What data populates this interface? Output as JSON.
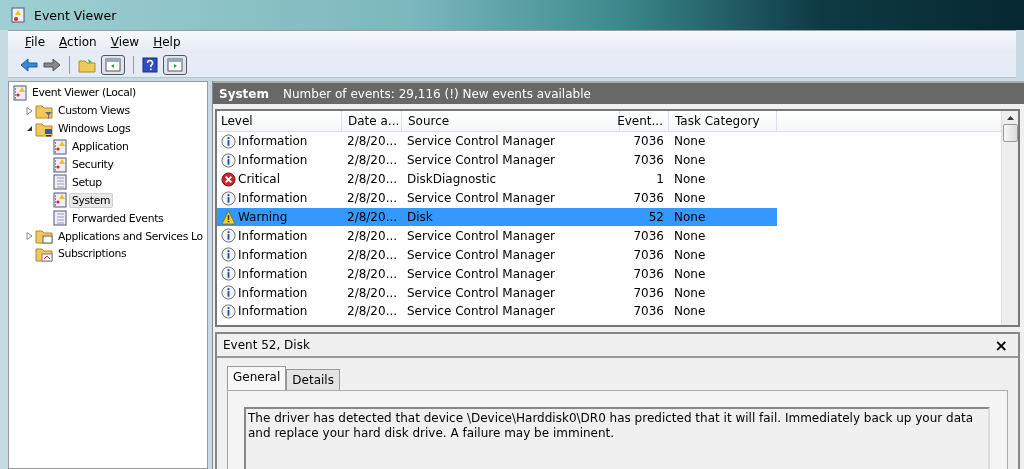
{
  "window": {
    "title": "Event Viewer"
  },
  "menu": [
    "File",
    "Action",
    "View",
    "Help"
  ],
  "tree": [
    {
      "label": "Event Viewer (Local)",
      "kind": "viewer",
      "selected": false,
      "children": [
        {
          "label": "Custom Views",
          "kind": "folder-filter",
          "expanded": false,
          "selected": false
        },
        {
          "label": "Windows Logs",
          "kind": "folder-computer",
          "expanded": true,
          "selected": false,
          "children": [
            {
              "label": "Application",
              "kind": "log-alert",
              "selected": false
            },
            {
              "label": "Security",
              "kind": "log-alert",
              "selected": false
            },
            {
              "label": "Setup",
              "kind": "log",
              "selected": false
            },
            {
              "label": "System",
              "kind": "log-alert",
              "selected": true
            },
            {
              "label": "Forwarded Events",
              "kind": "log",
              "selected": false
            }
          ]
        },
        {
          "label": "Applications and Services Lo",
          "kind": "folder-window",
          "expanded": false,
          "selected": false
        },
        {
          "label": "Subscriptions",
          "kind": "subscriptions",
          "selected": false
        }
      ]
    }
  ],
  "header": {
    "title": "System",
    "info": "Number of events: 29,116 (!) New events available"
  },
  "table": {
    "columns": [
      "Level",
      "Date a...",
      "Source",
      "Event...",
      "Task Category"
    ],
    "rows": [
      {
        "kind": "info",
        "level": "Information",
        "date": "2/8/20...",
        "source": "Service Control Manager",
        "event": "7036",
        "category": "None",
        "selected": false
      },
      {
        "kind": "info",
        "level": "Information",
        "date": "2/8/20...",
        "source": "Service Control Manager",
        "event": "7036",
        "category": "None",
        "selected": false
      },
      {
        "kind": "critical",
        "level": "Critical",
        "date": "2/8/20...",
        "source": "DiskDiagnostic",
        "event": "1",
        "category": "None",
        "selected": false
      },
      {
        "kind": "info",
        "level": "Information",
        "date": "2/8/20...",
        "source": "Service Control Manager",
        "event": "7036",
        "category": "None",
        "selected": false
      },
      {
        "kind": "warning",
        "level": "Warning",
        "date": "2/8/20...",
        "source": "Disk",
        "event": "52",
        "category": "None",
        "selected": true
      },
      {
        "kind": "info",
        "level": "Information",
        "date": "2/8/20...",
        "source": "Service Control Manager",
        "event": "7036",
        "category": "None",
        "selected": false
      },
      {
        "kind": "info",
        "level": "Information",
        "date": "2/8/20...",
        "source": "Service Control Manager",
        "event": "7036",
        "category": "None",
        "selected": false
      },
      {
        "kind": "info",
        "level": "Information",
        "date": "2/8/20...",
        "source": "Service Control Manager",
        "event": "7036",
        "category": "None",
        "selected": false
      },
      {
        "kind": "info",
        "level": "Information",
        "date": "2/8/20...",
        "source": "Service Control Manager",
        "event": "7036",
        "category": "None",
        "selected": false
      },
      {
        "kind": "info",
        "level": "Information",
        "date": "2/8/20...",
        "source": "Service Control Manager",
        "event": "7036",
        "category": "None",
        "selected": false
      }
    ]
  },
  "detail": {
    "title": "Event 52, Disk",
    "close": "×",
    "tabs": [
      {
        "label": "General",
        "selected": true
      },
      {
        "label": "Details",
        "selected": false
      }
    ],
    "message": "The driver has detected that device \\Device\\Harddisk0\\DR0 has predicted that it will fail. Immediately back up your data and replace your hard disk drive. A failure may be imminent."
  }
}
